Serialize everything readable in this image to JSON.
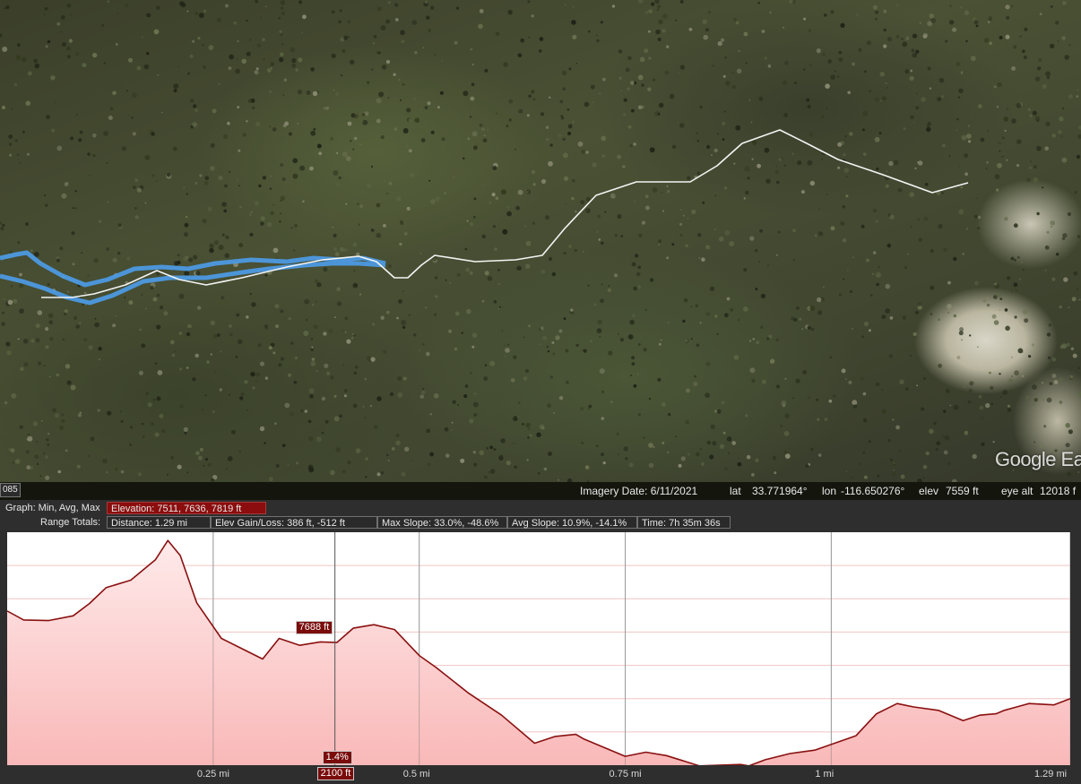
{
  "map": {
    "watermark": "Google Ea",
    "scale_badge": "085"
  },
  "statusbar": {
    "imagery_date": "Imagery Date: 6/11/2021",
    "lat_label": "lat",
    "lat_value": "33.771964°",
    "lon_label": "lon",
    "lon_value": "-116.650276°",
    "elev_label": "elev",
    "elev_value": "7559 ft",
    "eye_alt_label": "eye alt",
    "eye_alt_value": "12018 f"
  },
  "profile": {
    "graph_label": "Graph: Min, Avg, Max",
    "elevation_stats": "Elevation: 7511, 7636, 7819 ft",
    "range_label": "Range Totals:",
    "distance": "Distance: 1.29 mi",
    "elev_gain_loss": "Elev Gain/Loss: 386 ft, -512 ft",
    "max_slope": "Max Slope: 33.0%, -48.6%",
    "avg_slope": "Avg Slope: 10.9%, -14.1%",
    "time": "Time: 7h 35m 36s",
    "cursor_elev": "7688 ft",
    "cursor_slope": "1.4%",
    "cursor_distance": "2100 ft",
    "colors": {
      "line": "#8a1010",
      "fill": "#f9b8b8",
      "tag": "#7a0c0c",
      "highlight": "#8b0d0d"
    }
  },
  "chart_data": {
    "type": "area",
    "xlabel": "",
    "ylabel": "",
    "x_unit": "mi",
    "y_unit": "ft",
    "xlim": [
      0,
      1.29
    ],
    "ylim": [
      7490,
      7830
    ],
    "x_tick_labels": [
      "0.25 mi",
      "0.5 mi",
      "0.75 mi",
      "1 mi",
      "1.29 mi"
    ],
    "x_ticks": [
      0.25,
      0.5,
      0.75,
      1.0,
      1.29
    ],
    "series": [
      {
        "points": [
          [
            0.0,
            7715
          ],
          [
            0.02,
            7702
          ],
          [
            0.05,
            7701
          ],
          [
            0.08,
            7708
          ],
          [
            0.1,
            7726
          ],
          [
            0.12,
            7749
          ],
          [
            0.15,
            7760
          ],
          [
            0.18,
            7790
          ],
          [
            0.195,
            7818
          ],
          [
            0.21,
            7796
          ],
          [
            0.23,
            7727
          ],
          [
            0.26,
            7675
          ],
          [
            0.285,
            7660
          ],
          [
            0.31,
            7645
          ],
          [
            0.33,
            7675
          ],
          [
            0.355,
            7665
          ],
          [
            0.38,
            7670
          ],
          [
            0.4,
            7669
          ],
          [
            0.42,
            7690
          ],
          [
            0.445,
            7695
          ],
          [
            0.47,
            7688
          ],
          [
            0.5,
            7650
          ],
          [
            0.52,
            7633
          ],
          [
            0.56,
            7595
          ],
          [
            0.6,
            7563
          ],
          [
            0.64,
            7522
          ],
          [
            0.665,
            7532
          ],
          [
            0.69,
            7535
          ],
          [
            0.7,
            7528
          ],
          [
            0.75,
            7503
          ],
          [
            0.775,
            7509
          ],
          [
            0.8,
            7504
          ],
          [
            0.84,
            7489
          ],
          [
            0.89,
            7491
          ],
          [
            0.9,
            7489
          ],
          [
            0.92,
            7498
          ],
          [
            0.95,
            7507
          ],
          [
            0.98,
            7512
          ],
          [
            1.03,
            7533
          ],
          [
            1.055,
            7565
          ],
          [
            1.08,
            7580
          ],
          [
            1.1,
            7575
          ],
          [
            1.13,
            7570
          ],
          [
            1.16,
            7555
          ],
          [
            1.18,
            7563
          ],
          [
            1.2,
            7565
          ],
          [
            1.21,
            7570
          ],
          [
            1.225,
            7575
          ],
          [
            1.24,
            7580
          ],
          [
            1.27,
            7578
          ],
          [
            1.29,
            7587
          ]
        ]
      }
    ],
    "cursor": {
      "x_ft": 2100,
      "elevation_ft": 7688,
      "slope_pct": 1.4
    }
  }
}
